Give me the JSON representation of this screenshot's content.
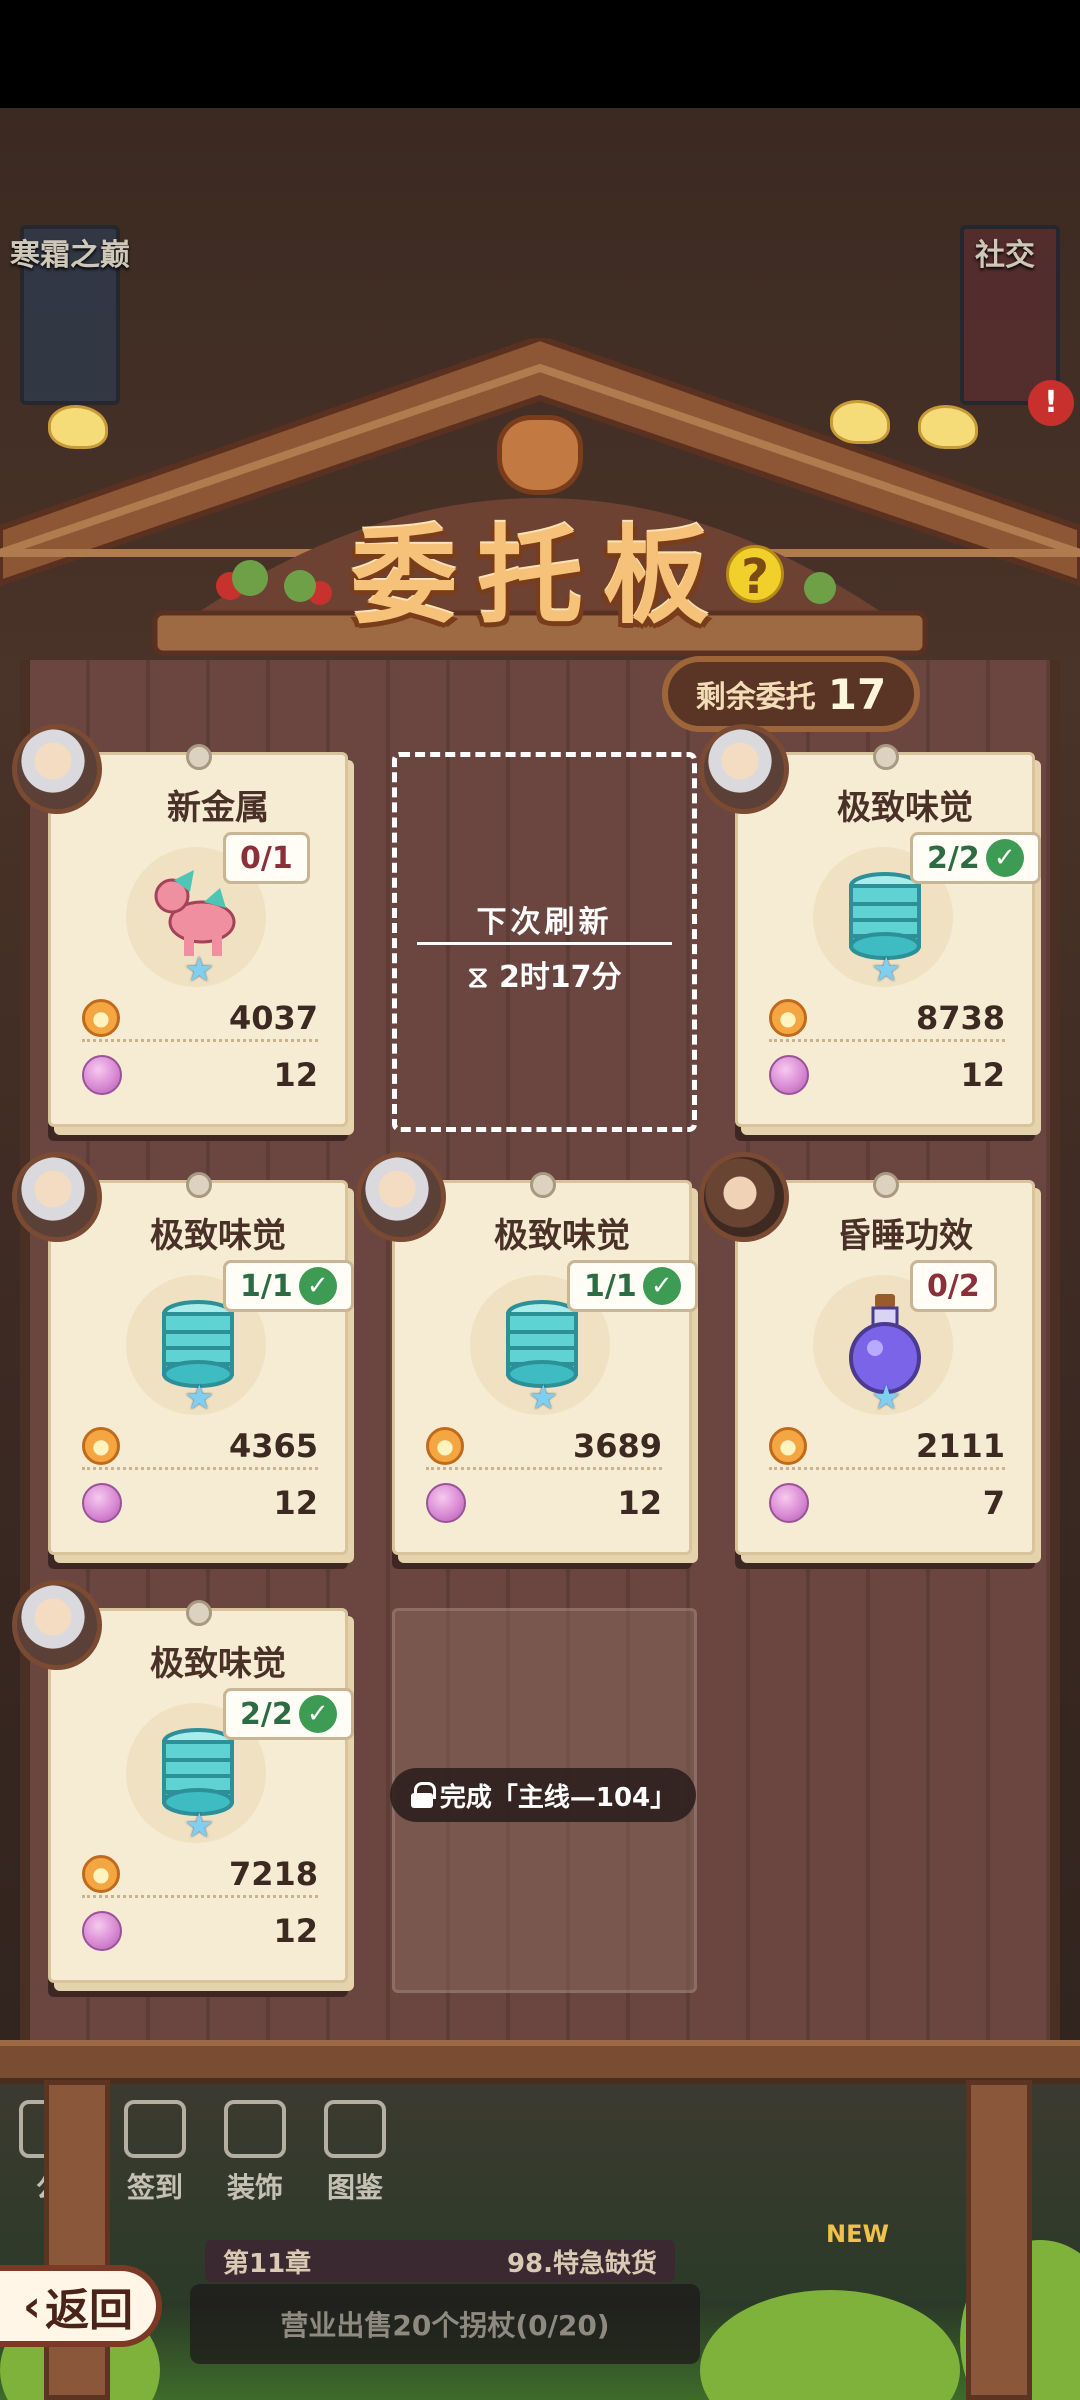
{
  "board": {
    "title": "委托板",
    "help_icon": "?",
    "remaining_label": "剩余委托",
    "remaining_count": "17"
  },
  "background": {
    "left_banner": "寒霜之巅",
    "right_banner": "社交",
    "alert": "!"
  },
  "refresh": {
    "label": "下次刷新",
    "timer": "2时17分"
  },
  "cards": [
    {
      "title": "新金属",
      "progress": "0/1",
      "done": false,
      "item_icon": "dragon-figure-icon",
      "coins": "4037",
      "gems": "12"
    },
    {
      "title": "极致味觉",
      "progress": "2/2",
      "done": true,
      "item_icon": "teal-spring-coil-icon",
      "coins": "8738",
      "gems": "12"
    },
    {
      "title": "极致味觉",
      "progress": "1/1",
      "done": true,
      "item_icon": "teal-spring-coil-icon",
      "coins": "4365",
      "gems": "12"
    },
    {
      "title": "极致味觉",
      "progress": "1/1",
      "done": true,
      "item_icon": "teal-spring-coil-icon",
      "coins": "3689",
      "gems": "12"
    },
    {
      "title": "昏睡功效",
      "progress": "0/2",
      "done": false,
      "item_icon": "purple-potion-icon",
      "coins": "2111",
      "gems": "7"
    },
    {
      "title": "极致味觉",
      "progress": "2/2",
      "done": true,
      "item_icon": "teal-spring-coil-icon",
      "coins": "7218",
      "gems": "12"
    }
  ],
  "locked": {
    "label": "完成「主线—104」"
  },
  "bottom": {
    "nav": [
      "公",
      "签到",
      "装饰",
      "图鉴"
    ],
    "chapter": "第11章",
    "chapter_quest_title": "98.特急缺货",
    "quest_text": "营业出售20个拐杖(0/20)",
    "new_tag": "NEW",
    "back_label": "返回"
  },
  "colors": {
    "title": "#f6c27a",
    "card_paper": "#f6ecd3",
    "check_green": "#3e9b54",
    "progress_incomplete": "#8b2f3a"
  }
}
